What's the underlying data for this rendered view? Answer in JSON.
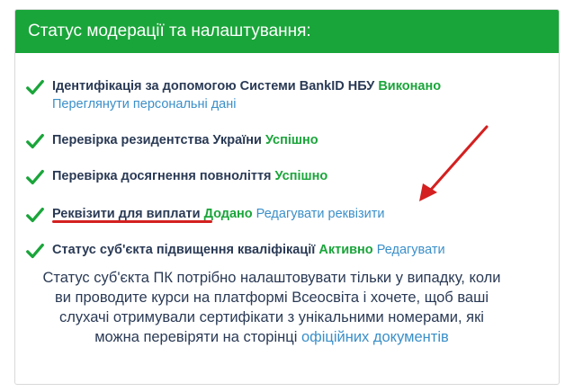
{
  "card": {
    "title": "Статус модерації та налаштування:",
    "colors": {
      "header_bg": "#1aa53a",
      "status_green": "#1aa53a",
      "link_blue": "#3a8fc9",
      "annotation_red": "#d42020"
    }
  },
  "items": [
    {
      "label": "Ідентифікація за допомогою Системи BankID НБУ",
      "status": "Виконано",
      "link": "Переглянути персональні дані",
      "icon": "checkmark-icon"
    },
    {
      "label": "Перевірка резидентства України",
      "status": "Успішно",
      "icon": "checkmark-icon"
    },
    {
      "label": "Перевірка досягнення повноліття",
      "status": "Успішно",
      "icon": "checkmark-icon"
    },
    {
      "label": "Реквізити для виплати",
      "status": "Додано",
      "link": "Редагувати реквізити",
      "icon": "checkmark-icon"
    },
    {
      "label": "Статус суб'єкта підвищення кваліфікації",
      "status": "Активно",
      "link": "Редагувати",
      "icon": "checkmark-icon"
    }
  ],
  "note": {
    "text": "Статус суб'єкта ПК потрібно налаштовувати тільки у випадку, коли ви проводите курси на платформі Всеосвіта і хочете, щоб ваші слухачі отримували сертифікати з унікальними номерами, які можна перевіряти на сторінці",
    "link": "офіційних документів"
  }
}
